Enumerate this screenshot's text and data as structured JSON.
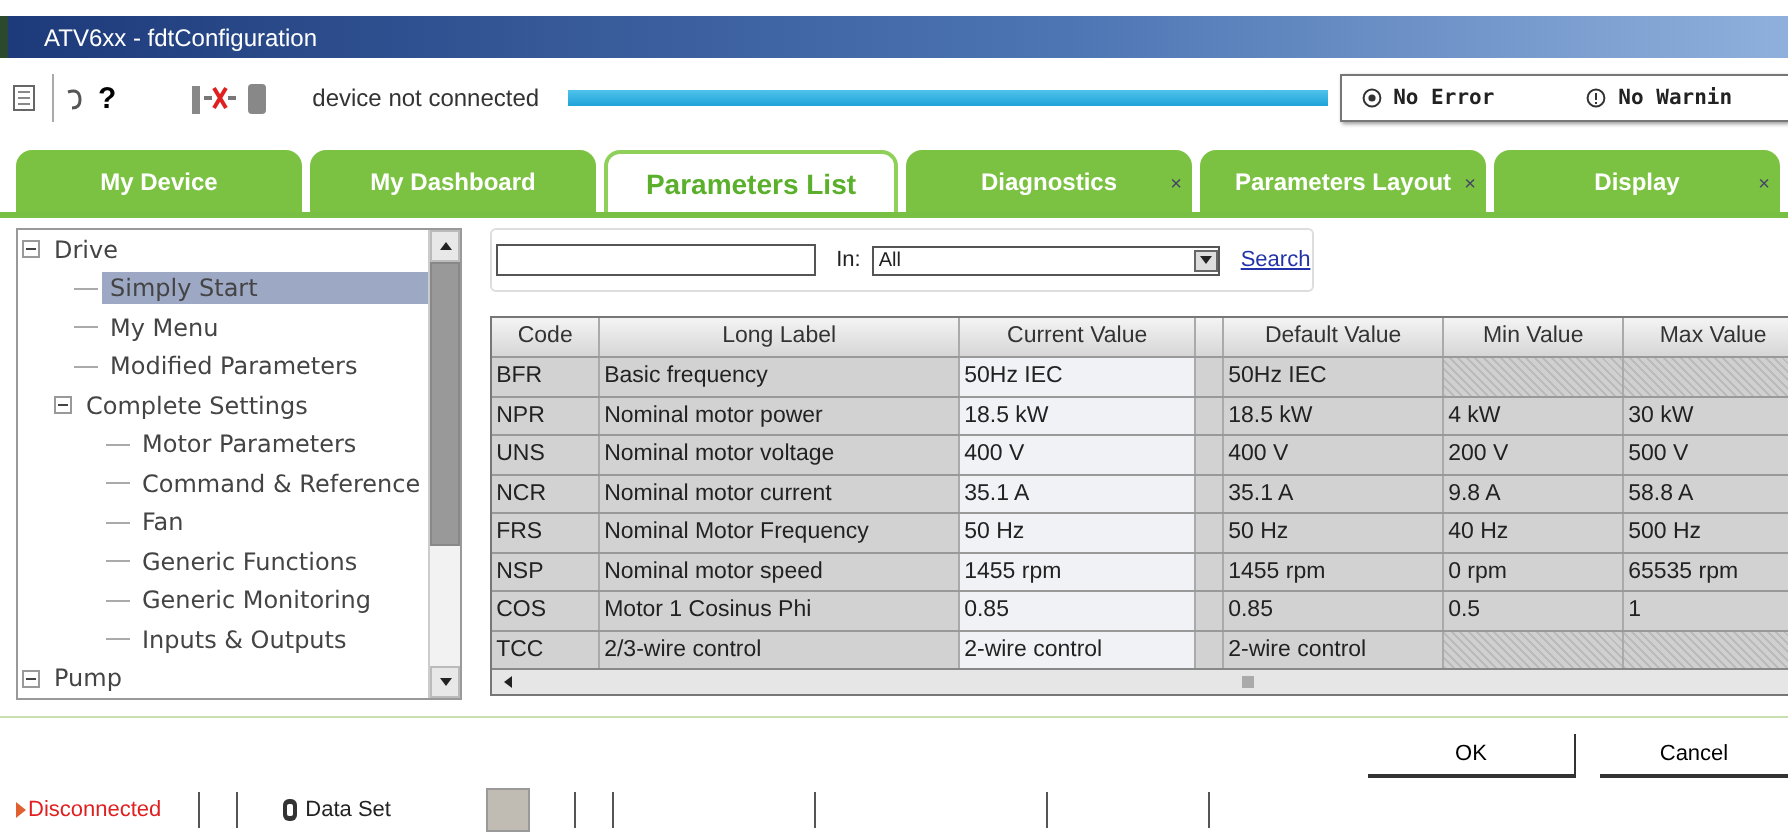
{
  "window": {
    "title": "ATV6xx - fdtConfiguration"
  },
  "toolbar": {
    "status_text": "device not connected",
    "help": "?",
    "error": "No Error",
    "warning": "No Warnin",
    "progress": {
      "level": 1
    }
  },
  "tabs": [
    {
      "label": "My Device",
      "selected": false
    },
    {
      "label": "My Dashboard",
      "selected": false
    },
    {
      "label": "Parameters List",
      "selected": true
    },
    {
      "label": "Diagnostics",
      "selected": false,
      "close": "×"
    },
    {
      "label": "Parameters Layout",
      "selected": false,
      "close": "×"
    },
    {
      "label": "Display",
      "selected": false,
      "close": "×"
    }
  ],
  "tree": [
    {
      "label": "Drive",
      "expanded": true,
      "selected": false,
      "children": [
        {
          "label": "Simply Start",
          "selected": true
        },
        {
          "label": "My Menu",
          "selected": false
        },
        {
          "label": "Modified Parameters",
          "selected": false
        },
        {
          "label": "Complete Settings",
          "expanded": true,
          "selected": false,
          "children": [
            {
              "label": "Motor Parameters",
              "selected": false
            },
            {
              "label": "Command & Reference",
              "selected": false
            },
            {
              "label": "Fan",
              "selected": false
            },
            {
              "label": "Generic Functions",
              "selected": false
            },
            {
              "label": "Generic Monitoring",
              "selected": false
            },
            {
              "label": "Inputs & Outputs",
              "selected": false
            }
          ]
        }
      ]
    },
    {
      "label": "Pump",
      "expanded": true,
      "selected": false
    }
  ],
  "search": {
    "in_label": "In:",
    "scope": "All",
    "link": "Search"
  },
  "table": {
    "columns": [
      {
        "label": "Code",
        "kind": "text"
      },
      {
        "label": "Long Label",
        "kind": "text"
      },
      {
        "label": "Current Value",
        "kind": "edit"
      },
      {
        "kind": "spacer"
      },
      {
        "label": "Default Value",
        "kind": "text"
      },
      {
        "label": "Min Value",
        "kind": "text"
      },
      {
        "label": "Max Value",
        "kind": "text"
      }
    ],
    "rows": [
      [
        "BFR",
        "Basic frequency",
        "50Hz IEC",
        null,
        "50Hz IEC",
        null,
        null
      ],
      [
        "NPR",
        "Nominal motor power",
        "18.5 kW",
        null,
        "18.5 kW",
        "4 kW",
        "30 kW"
      ],
      [
        "UNS",
        "Nominal motor voltage",
        "400 V",
        null,
        "400 V",
        "200 V",
        "500 V"
      ],
      [
        "NCR",
        "Nominal motor current",
        "35.1 A",
        null,
        "35.1 A",
        "9.8 A",
        "58.8 A"
      ],
      [
        "FRS",
        "Nominal Motor Frequency",
        "50 Hz",
        null,
        "50 Hz",
        "40 Hz",
        "500 Hz"
      ],
      [
        "NSP",
        "Nominal motor speed",
        "1455 rpm",
        null,
        "1455 rpm",
        "0 rpm",
        "65535 rpm"
      ],
      [
        "COS",
        "Motor 1 Cosinus Phi",
        "0.85",
        null,
        "0.85",
        "0.5",
        "1"
      ],
      [
        "TCC",
        "2/3-wire control",
        "2-wire control",
        null,
        "2-wire control",
        null,
        null
      ]
    ]
  },
  "buttons": [
    "OK",
    "Cancel"
  ],
  "status_bar": {
    "connection": "Disconnected",
    "dataset": "Data Set"
  }
}
